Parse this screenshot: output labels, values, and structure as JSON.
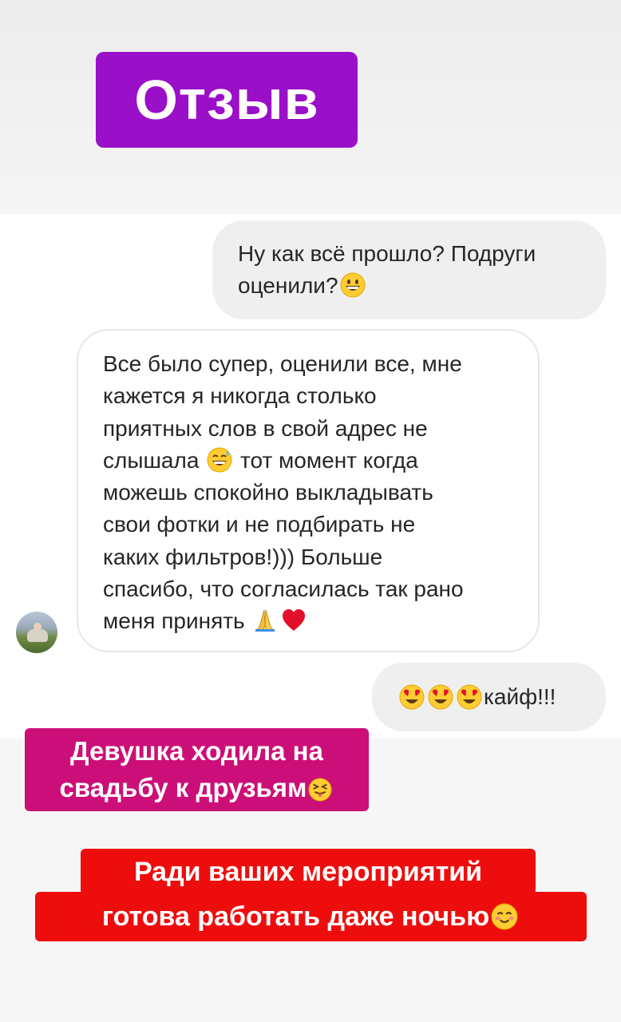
{
  "header": {
    "title": "Отзыв"
  },
  "chat": {
    "outgoing_1": {
      "lines": [
        "Ну как всё прошло? Подруги",
        "оценили?"
      ],
      "trailing_emoji": "grinning-face"
    },
    "incoming": {
      "lines": [
        "Все было супер, оценили все, мне",
        "кажется я никогда столько",
        "приятных слов в свой адрес не",
        "слышала",
        "тот момент когда",
        "можешь спокойно выкладывать",
        "свои фотки и не подбирать не",
        "каких фильтров!))) Больше",
        "спасибо, что согласилась так рано",
        "меня принять"
      ],
      "emojis": [
        "grinning-sweat-face",
        "folded-hands",
        "red-heart"
      ]
    },
    "outgoing_2": {
      "text": "кайф!!!",
      "emojis": [
        "heart-eyes-face",
        "heart-eyes-face",
        "heart-eyes-face"
      ]
    }
  },
  "captions": {
    "caption_1": {
      "lines": [
        "Девушка ходила на",
        "свадьбу к друзьям"
      ],
      "emoji": "squinting-tongue-face"
    },
    "caption_2": {
      "lines": [
        "Ради ваших мероприятий",
        "готова работать даже ночью"
      ],
      "emoji": "smiling-blush-face"
    }
  },
  "colors": {
    "title_bg": "#9a0fc8",
    "caption_1_bg": "#cc0f78",
    "caption_2_bg": "#ee0d0d",
    "bubble_outgoing": "#efefef",
    "bubble_incoming_border": "#e6e6e6",
    "text": "#262626"
  }
}
